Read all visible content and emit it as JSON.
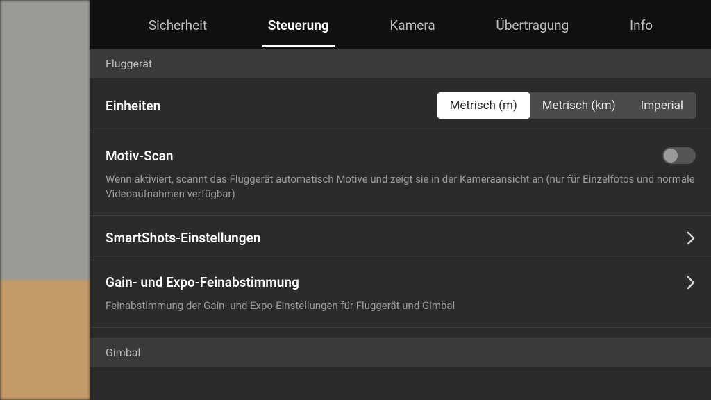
{
  "tabs": {
    "items": [
      {
        "label": "Sicherheit",
        "active": false
      },
      {
        "label": "Steuerung",
        "active": true
      },
      {
        "label": "Kamera",
        "active": false
      },
      {
        "label": "Übertragung",
        "active": false
      },
      {
        "label": "Info",
        "active": false
      }
    ]
  },
  "sections": {
    "aircraft": {
      "header": "Fluggerät"
    },
    "gimbal": {
      "header": "Gimbal"
    }
  },
  "settings": {
    "units": {
      "title": "Einheiten",
      "options": [
        "Metrisch (m)",
        "Metrisch (km)",
        "Imperial"
      ],
      "selected": 0
    },
    "subject_scan": {
      "title": "Motiv-Scan",
      "enabled": false,
      "desc": "Wenn aktiviert, scannt das Fluggerät automatisch Motive und zeigt sie in der Kameraansicht an (nur für Einzelfotos und normale Videoaufnahmen verfügbar)"
    },
    "smartshots": {
      "title": "SmartShots-Einstellungen"
    },
    "gain_expo": {
      "title": "Gain- und Expo-Feinabstimmung",
      "desc": "Feinabstimmung der Gain- und Expo-Einstellungen für Fluggerät und Gimbal"
    }
  }
}
